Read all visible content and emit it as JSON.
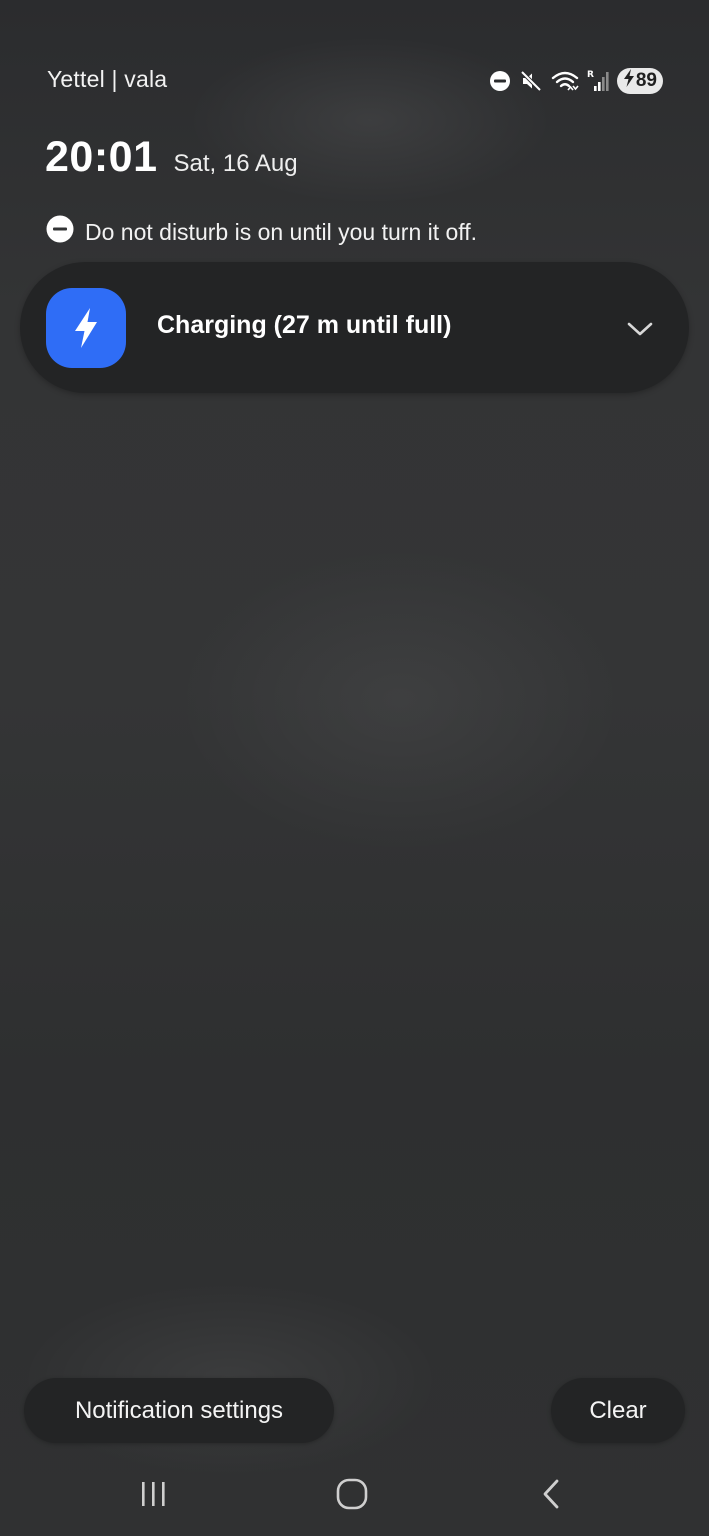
{
  "status_bar": {
    "carrier": "Yettel | vala",
    "icons": [
      "dnd-icon",
      "mute-icon",
      "wifi-icon",
      "signal-icon"
    ],
    "battery": {
      "level": "89",
      "charging": true
    }
  },
  "lock_header": {
    "time": "20:01",
    "date": "Sat, 16 Aug"
  },
  "dnd_banner": {
    "text": "Do not disturb is on until you turn it off."
  },
  "notifications": [
    {
      "title": "Charging (27 m until full)",
      "icon": "lightning-icon",
      "icon_bg": "#2f6df6"
    }
  ],
  "actions": {
    "settings_label": "Notification settings",
    "clear_label": "Clear"
  },
  "nav_bar": {
    "buttons": [
      "recents",
      "home",
      "back"
    ]
  }
}
